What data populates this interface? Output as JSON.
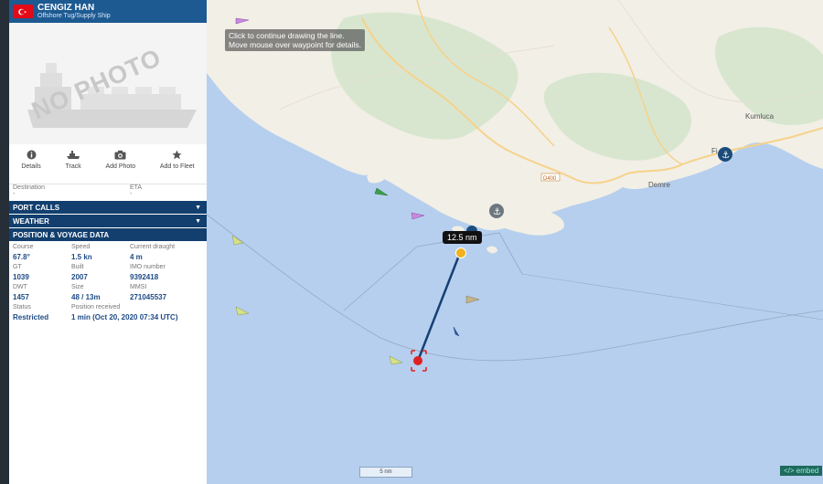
{
  "vessel": {
    "name": "CENGIZ HAN",
    "type": "Offshore Tug/Supply Ship",
    "no_photo_text": "NO PHOTO"
  },
  "actions": [
    {
      "label": "Details",
      "icon": "info-icon"
    },
    {
      "label": "Track",
      "icon": "ship-track-icon"
    },
    {
      "label": "Add Photo",
      "icon": "camera-icon"
    },
    {
      "label": "Add to Fleet",
      "icon": "star-icon"
    }
  ],
  "voyage": {
    "destination_label": "Destination",
    "destination_value": "-",
    "eta_label": "ETA",
    "eta_value": "-"
  },
  "sections": {
    "port_calls": "PORT CALLS",
    "weather": "WEATHER",
    "position": "POSITION & VOYAGE DATA"
  },
  "data": {
    "course_label": "Course",
    "course": "67.8°",
    "speed_label": "Speed",
    "speed": "1.5 kn",
    "draught_label": "Current draught",
    "draught": "4 m",
    "gt_label": "GT",
    "gt": "1039",
    "built_label": "Built",
    "built": "2007",
    "imo_label": "IMO number",
    "imo": "9392418",
    "dwt_label": "DWT",
    "dwt": "1457",
    "size_label": "Size",
    "size": "48 / 13m",
    "mmsi_label": "MMSI",
    "mmsi": "271045537",
    "status_label": "Status",
    "status": "Restricted",
    "received_label": "Position received",
    "received": "1 min (Oct 20, 2020 07:34 UTC)"
  },
  "map": {
    "hint_line1": "Click to continue drawing the line.",
    "hint_line2": "Move mouse over waypoint for details.",
    "distance": "12.5 nm",
    "scale": "5 nm",
    "embed": "</> embed",
    "labels": {
      "demre": "Demre",
      "kumluca": "Kumluca",
      "road": "D400",
      "fi": "Fi"
    }
  },
  "colors": {
    "header": "#1d5a92",
    "section": "#123f6e",
    "sea": "#b6cfee",
    "land": "#f2efe6",
    "forest": "#d8e6cf",
    "ship_marker": "#e02020",
    "measure_line": "#163f74",
    "waypoint": "#f2b01c"
  }
}
